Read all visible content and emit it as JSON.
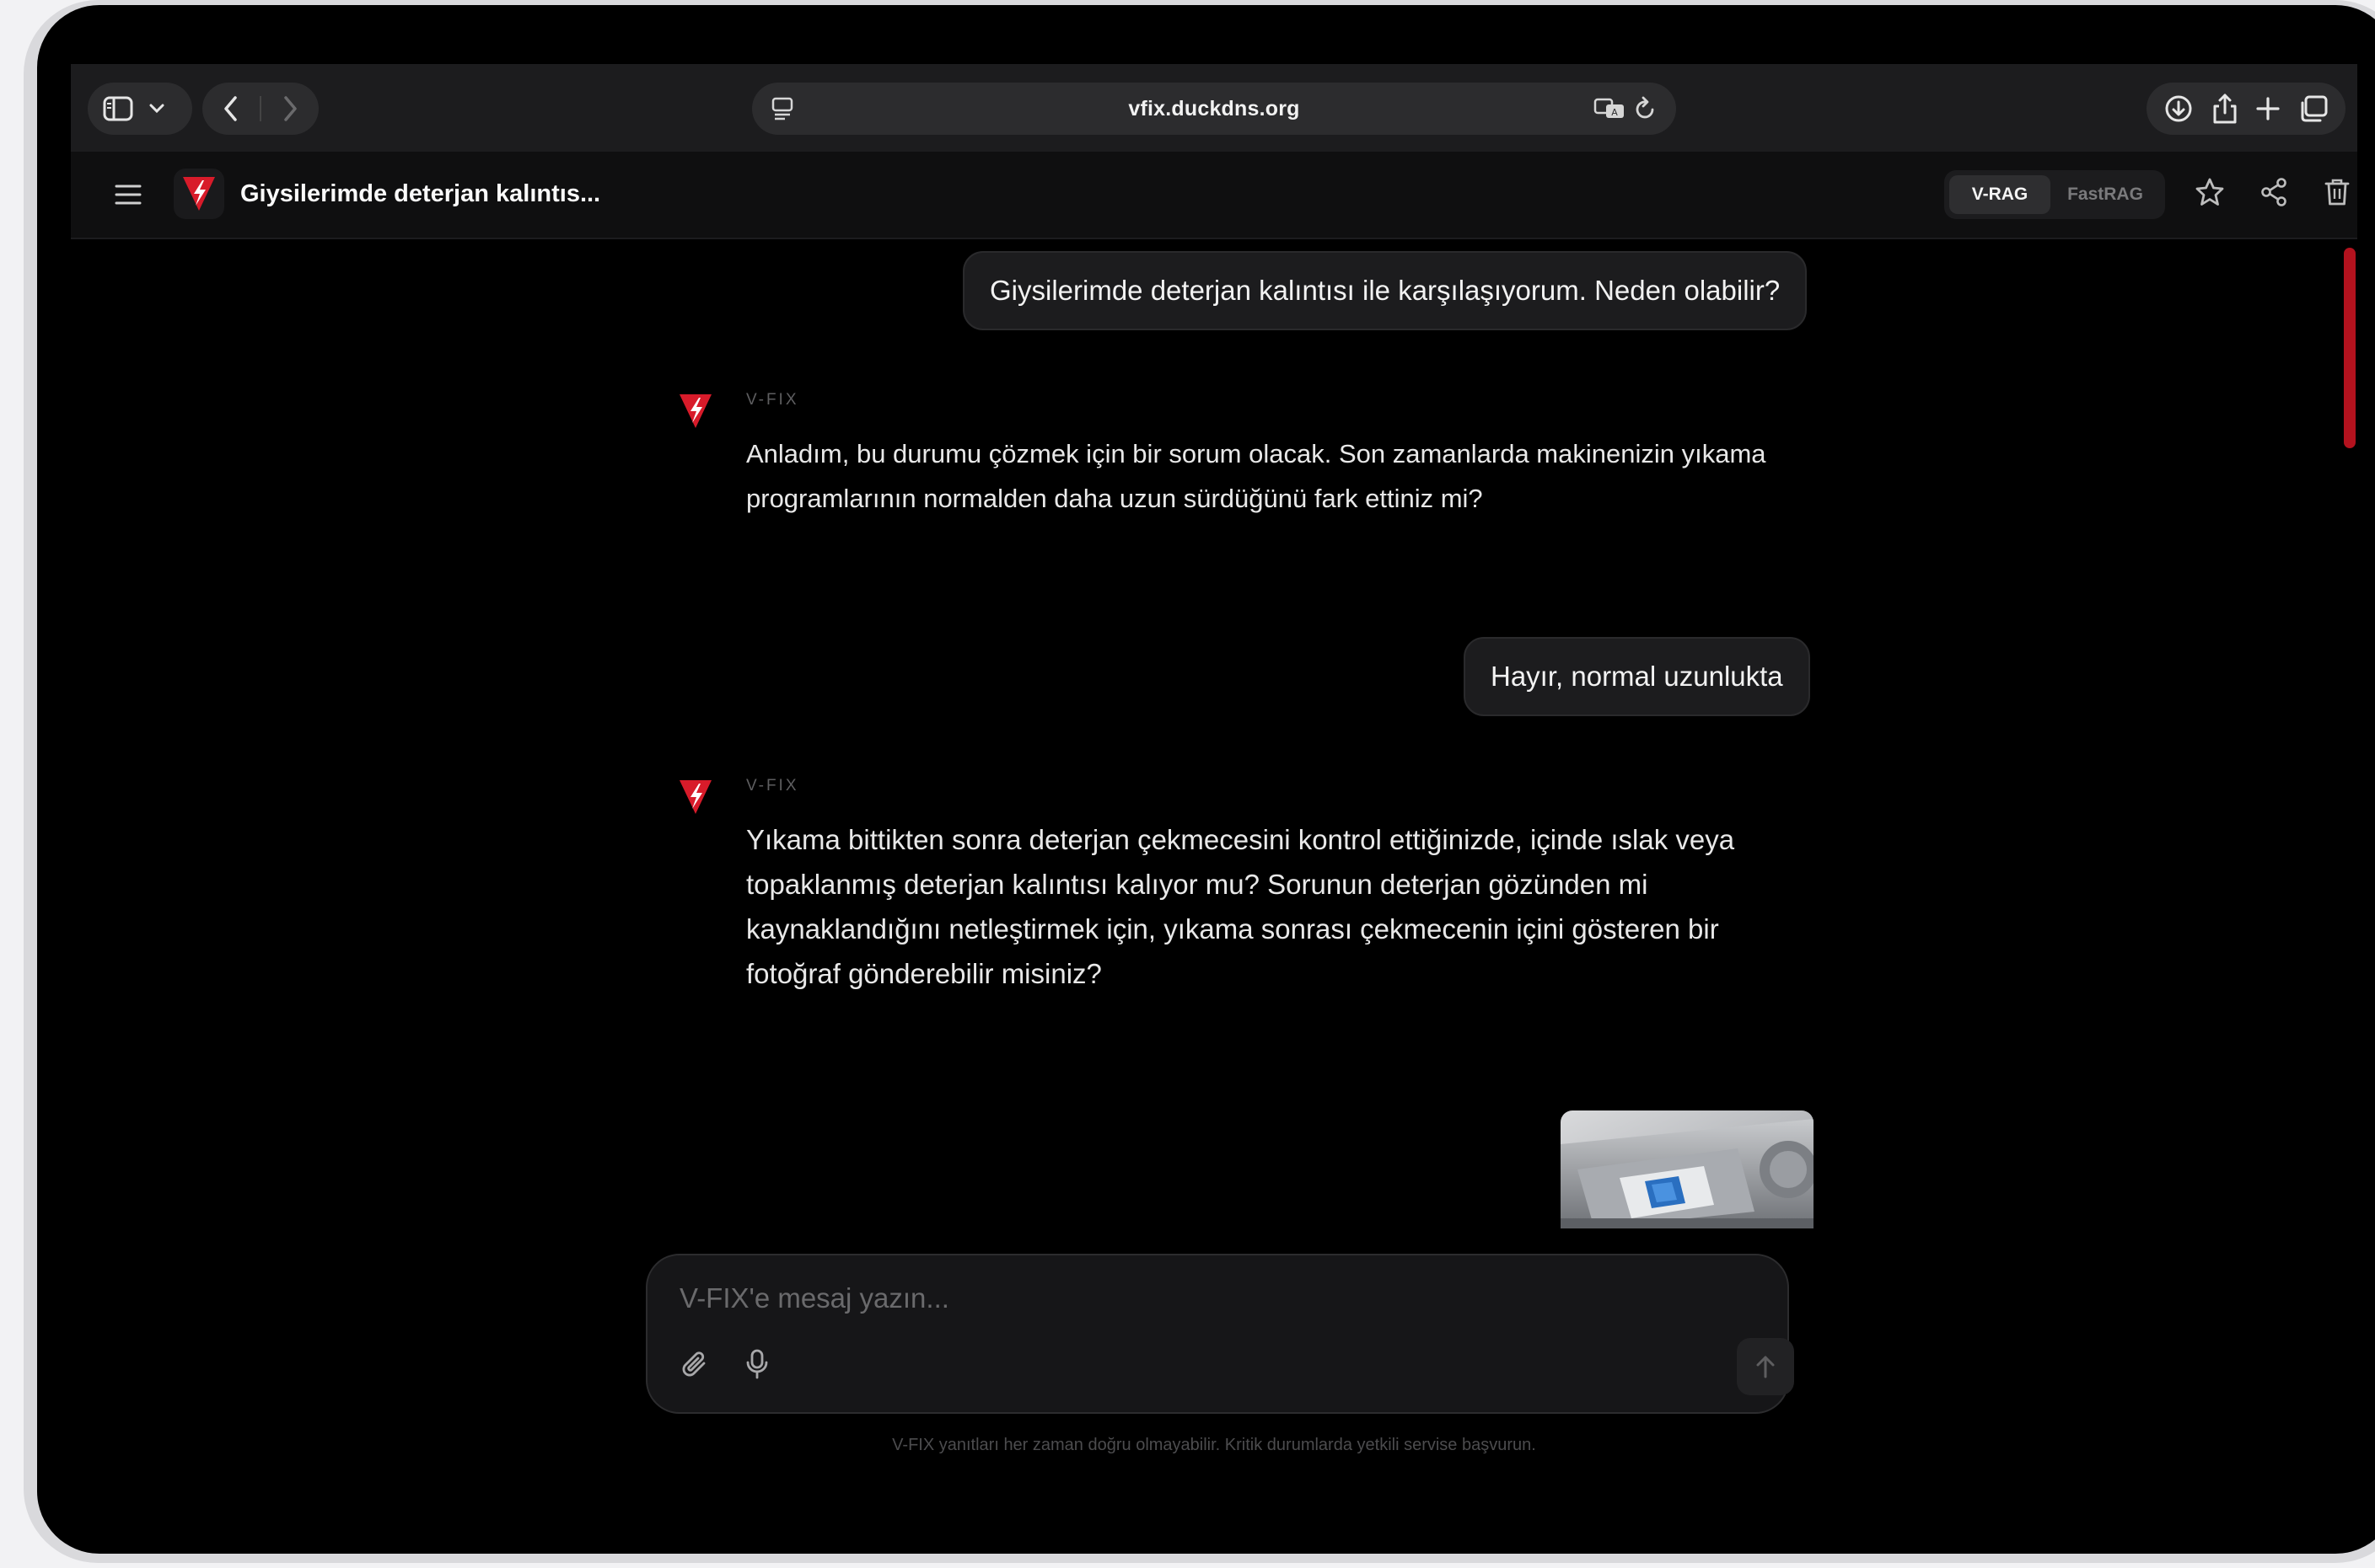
{
  "browser": {
    "url": "vfix.duckdns.org"
  },
  "header": {
    "title": "Giysilerimde deterjan kalıntıs...",
    "modes": [
      "V-RAG",
      "FastRAG"
    ],
    "active_mode": "V-RAG"
  },
  "messages": [
    {
      "role": "user",
      "text": "Giysilerimde deterjan kalıntısı ile karşılaşıyorum. Neden olabilir?"
    },
    {
      "role": "assistant",
      "sender": "V-FIX",
      "lines": [
        "Anladım, bu durumu çözmek için bir sorum olacak. Son zamanlarda makinenizin yıkama",
        "programlarının normalden daha uzun sürdüğünü fark ettiniz mi?"
      ]
    },
    {
      "role": "user",
      "text": "Hayır, normal uzunlukta"
    },
    {
      "role": "assistant",
      "sender": "V-FIX",
      "lines": [
        "Yıkama bittikten sonra deterjan çekmecesini kontrol ettiğinizde, içinde ıslak veya",
        "topaklanmış deterjan kalıntısı kalıyor mu? Sorunun deterjan gözünden mi",
        "kaynaklandığını netleştirmek için, yıkama sonrası çekmecenin içini gösteren bir",
        "fotoğraf gönderebilir misiniz?"
      ]
    },
    {
      "role": "user",
      "attachment": "washing-machine-detergent-drawer-photo"
    }
  ],
  "composer": {
    "placeholder": "V-FIX'e mesaj yazın..."
  },
  "disclaimer": "V-FIX yanıtları her zaman doğru olmayabilir. Kritik durumlarda yetkili servise başvurun.",
  "colors": {
    "accent_red": "#d81b2a",
    "background": "#000000",
    "bubble": "#1c1c1e"
  }
}
